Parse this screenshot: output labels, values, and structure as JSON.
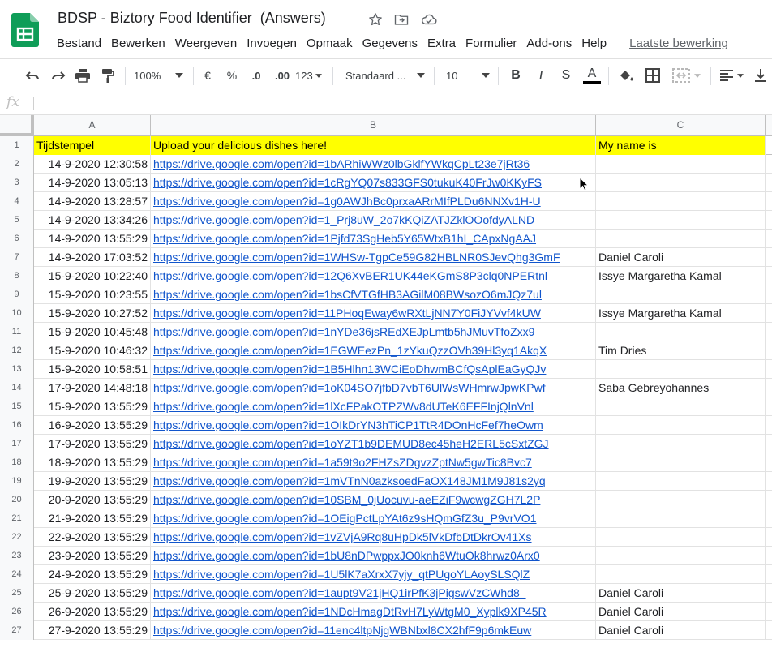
{
  "app": {
    "title": "BDSP - Biztory Food Identifier  (Answers)",
    "icons": [
      "sheets-logo",
      "star-icon",
      "move-to-folder-icon",
      "cloud-status-icon"
    ]
  },
  "menu": [
    "Bestand",
    "Bewerken",
    "Weergeven",
    "Invoegen",
    "Opmaak",
    "Gegevens",
    "Extra",
    "Formulier",
    "Add-ons",
    "Help"
  ],
  "last_edit": "Laatste bewerking",
  "toolbar": {
    "zoom": "100%",
    "currency": "€",
    "percent": "%",
    "dec_decrease": ".0",
    "dec_increase": ".00",
    "more_formats": "123",
    "font": "Standaard ...",
    "font_size": "10",
    "bold": "B",
    "italic": "I",
    "strike": "S",
    "textcolor": "A"
  },
  "formula_bar": {
    "fx": "fx",
    "value": ""
  },
  "columns": [
    "A",
    "B",
    "C"
  ],
  "header_row": {
    "num": "1",
    "a": "Tijdstempel",
    "b": "Upload your delicious dishes here!",
    "c": "My name is"
  },
  "rows": [
    {
      "num": "2",
      "a": "14-9-2020 12:30:58",
      "b": "https://drive.google.com/open?id=1bARhiWWz0lbGklfYWkqCpLt23e7jRt36",
      "c": ""
    },
    {
      "num": "3",
      "a": "14-9-2020 13:05:13",
      "b": "https://drive.google.com/open?id=1cRgYQ07s833GFS0tukuK40FrJw0KKyFS",
      "c": ""
    },
    {
      "num": "4",
      "a": "14-9-2020 13:28:57",
      "b": "https://drive.google.com/open?id=1g0AWJhBc0prxaARrMIfPLDu6NNXv1H-U",
      "c": ""
    },
    {
      "num": "5",
      "a": "14-9-2020 13:34:26",
      "b": "https://drive.google.com/open?id=1_Prj8uW_2o7kKQiZATJZklOOofdyALND",
      "c": ""
    },
    {
      "num": "6",
      "a": "14-9-2020 13:55:29",
      "b": "https://drive.google.com/open?id=1Pjfd73SgHeb5Y65WtxB1hI_CApxNgAAJ",
      "c": ""
    },
    {
      "num": "7",
      "a": "14-9-2020 17:03:52",
      "b": "https://drive.google.com/open?id=1WHSw-TgpCe59G82HBLNR0SJevQhg3GmF",
      "c": "Daniel Caroli"
    },
    {
      "num": "8",
      "a": "15-9-2020 10:22:40",
      "b": "https://drive.google.com/open?id=12Q6XvBER1UK44eKGmS8P3clq0NPERtnl",
      "c": "Issye Margaretha Kamal"
    },
    {
      "num": "9",
      "a": "15-9-2020 10:23:55",
      "b": "https://drive.google.com/open?id=1bsCfVTGfHB3AGilM08BWsozO6mJQz7ul",
      "c": ""
    },
    {
      "num": "10",
      "a": "15-9-2020 10:27:52",
      "b": "https://drive.google.com/open?id=11PHoqEway6wRXtLjNN7Y0FiJYVvf4kUW",
      "c": "Issye Margaretha Kamal"
    },
    {
      "num": "11",
      "a": "15-9-2020 10:45:48",
      "b": "https://drive.google.com/open?id=1nYDe36jsREdXEJpLmtb5hJMuvTfoZxx9",
      "c": ""
    },
    {
      "num": "12",
      "a": "15-9-2020 10:46:32",
      "b": "https://drive.google.com/open?id=1EGWEezPn_1zYkuQzzOVh39Hl3yq1AkqX",
      "c": "Tim Dries"
    },
    {
      "num": "13",
      "a": "15-9-2020 10:58:51",
      "b": "https://drive.google.com/open?id=1B5Hlhn13WCiEoDhwmBCfQsAplEaGyQJv",
      "c": ""
    },
    {
      "num": "14",
      "a": "17-9-2020 14:48:18",
      "b": "https://drive.google.com/open?id=1oK04SO7jfbD7vbT6UlWsWHmrwJpwKPwf",
      "c": "Saba Gebreyohannes"
    },
    {
      "num": "15",
      "a": "15-9-2020 13:55:29",
      "b": "https://drive.google.com/open?id=1lXcFPakOTPZWv8dUTeK6EFFInjQlnVnl",
      "c": ""
    },
    {
      "num": "16",
      "a": "16-9-2020 13:55:29",
      "b": "https://drive.google.com/open?id=1OIkDrYN3hTiCP1TtR4DOnHcFef7heOwm",
      "c": ""
    },
    {
      "num": "17",
      "a": "17-9-2020 13:55:29",
      "b": "https://drive.google.com/open?id=1oYZT1b9DEMUD8ec45heH2ERL5cSxtZGJ",
      "c": ""
    },
    {
      "num": "18",
      "a": "18-9-2020 13:55:29",
      "b": "https://drive.google.com/open?id=1a59t9o2FHZsZDgvzZptNw5gwTic8Bvc7",
      "c": ""
    },
    {
      "num": "19",
      "a": "19-9-2020 13:55:29",
      "b": "https://drive.google.com/open?id=1mVTnN0azksoedFaOX148JM1M9J81s2yq",
      "c": ""
    },
    {
      "num": "20",
      "a": "20-9-2020 13:55:29",
      "b": "https://drive.google.com/open?id=10SBM_0jUocuvu-aeEZiF9wcwgZGH7L2P",
      "c": ""
    },
    {
      "num": "21",
      "a": "21-9-2020 13:55:29",
      "b": "https://drive.google.com/open?id=1OEigPctLpYAt6z9sHQmGfZ3u_P9vrVO1",
      "c": ""
    },
    {
      "num": "22",
      "a": "22-9-2020 13:55:29",
      "b": "https://drive.google.com/open?id=1vZVjA9Rq8uHpDk5lVkDfbDtDkrOv41Xs",
      "c": ""
    },
    {
      "num": "23",
      "a": "23-9-2020 13:55:29",
      "b": "https://drive.google.com/open?id=1bU8nDPwppxJO0knh6WtuOk8hrwz0Arx0",
      "c": ""
    },
    {
      "num": "24",
      "a": "24-9-2020 13:55:29",
      "b": "https://drive.google.com/open?id=1U5lK7aXrxX7yjy_qtPUgoYLAoySLSQlZ",
      "c": ""
    },
    {
      "num": "25",
      "a": "25-9-2020 13:55:29",
      "b": "https://drive.google.com/open?id=1aupt9V21jHQ1irPfK3jPigswVzCWhd8_",
      "c": "Daniel Caroli"
    },
    {
      "num": "26",
      "a": "26-9-2020 13:55:29",
      "b": "https://drive.google.com/open?id=1NDcHmagDtRvH7LyWtgM0_Xyplk9XP45R",
      "c": "Daniel Caroli"
    },
    {
      "num": "27",
      "a": "27-9-2020 13:55:29",
      "b": "https://drive.google.com/open?id=11enc4ltpNjgWBNbxl8CX2hfF9p6mkEuw",
      "c": "Daniel Caroli"
    }
  ],
  "colors": {
    "header_fill": "#ffff00",
    "link": "#1155cc",
    "logo": "#0f9d58"
  }
}
